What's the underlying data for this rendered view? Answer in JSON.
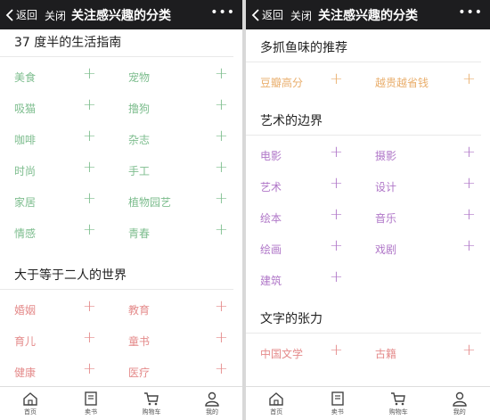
{
  "nav": {
    "back_label": "返回",
    "close_label": "关闭",
    "title": "关注感兴趣的分类",
    "more_label": "•••"
  },
  "colors": {
    "green": "#7dbd8e",
    "red": "#e48a8a",
    "orange": "#e9ae6c",
    "purple": "#b077c8"
  },
  "left_panel": {
    "sections": [
      {
        "title": "37 度半的生活指南",
        "color": "#7dbd8e",
        "items": [
          "美食",
          "宠物",
          "吸猫",
          "撸狗",
          "咖啡",
          "杂志",
          "时尚",
          "手工",
          "家居",
          "植物园艺",
          "情感",
          "青春"
        ]
      },
      {
        "title": "大于等于二人的世界",
        "color": "#e48a8a",
        "items": [
          "婚姻",
          "教育",
          "育儿",
          "童书",
          "健康",
          "医疗"
        ]
      }
    ]
  },
  "right_panel": {
    "sections": [
      {
        "title": "多抓鱼味的推荐",
        "color": "#e9ae6c",
        "items": [
          "豆瓣高分",
          "越贵越省钱"
        ]
      },
      {
        "title": "艺术的边界",
        "color": "#b077c8",
        "items": [
          "电影",
          "摄影",
          "艺术",
          "设计",
          "绘本",
          "音乐",
          "绘画",
          "戏剧",
          "建筑"
        ]
      },
      {
        "title": "文字的张力",
        "color": "#e48a8a",
        "items": [
          "中国文学",
          "古籍"
        ]
      }
    ]
  },
  "plus_label": "+",
  "tabbar": [
    {
      "label": "首页",
      "icon": "home-icon"
    },
    {
      "label": "卖书",
      "icon": "book-icon"
    },
    {
      "label": "购物车",
      "icon": "cart-icon"
    },
    {
      "label": "我的",
      "icon": "user-icon"
    }
  ]
}
